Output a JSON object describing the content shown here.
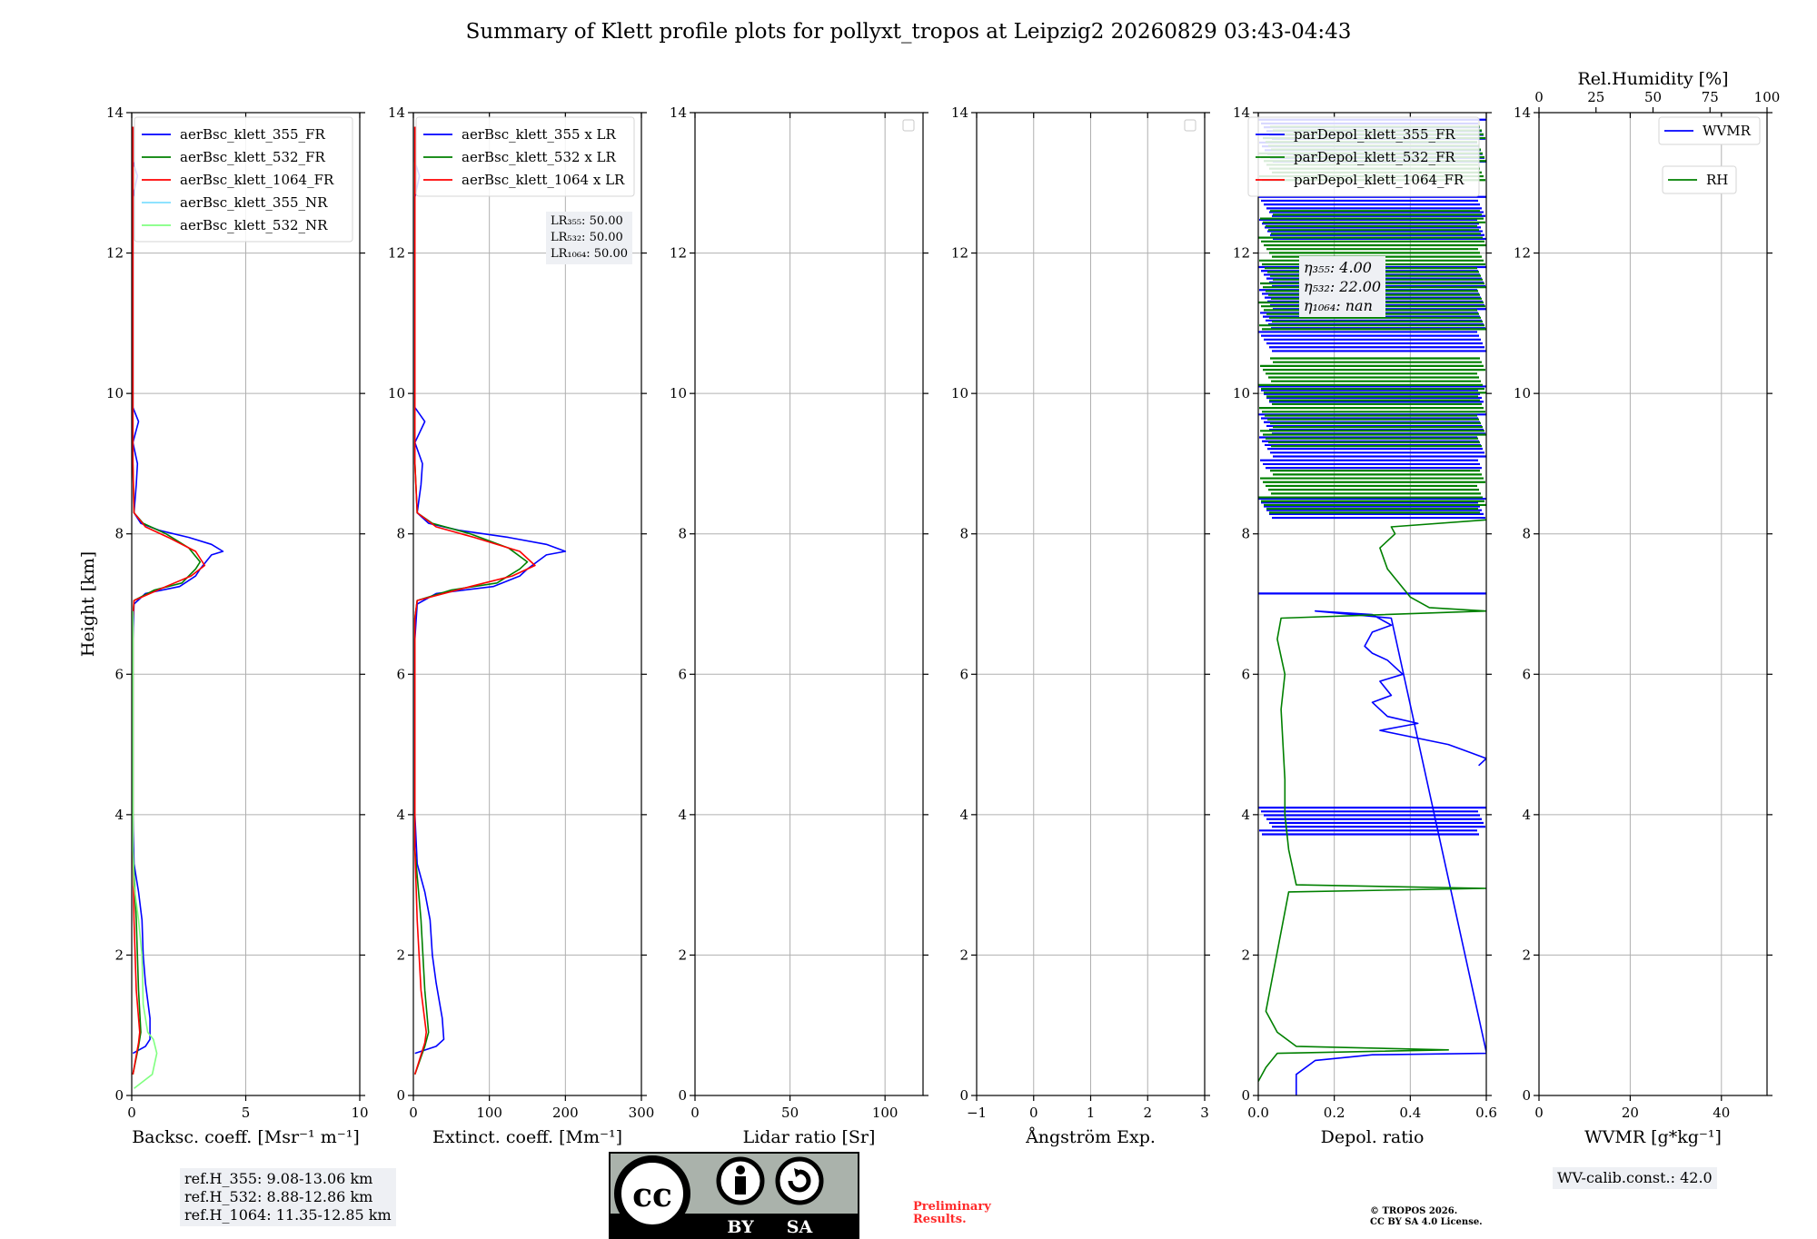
{
  "title": "Summary of Klett profile plots for pollyxt_tropos at Leipzig2 20260829 03:43-04:43",
  "colors": {
    "c355": "#0000ff",
    "c532": "#008000",
    "c1064": "#ff0000",
    "c355nr": "#7fdfff",
    "c532nr": "#80ff80"
  },
  "chart_data": [
    {
      "type": "line",
      "xlabel": "Backsc. coeff. [Msr⁻¹ m⁻¹]",
      "ylabel": "Height [km]",
      "xlim": [
        0,
        10
      ],
      "ylim": [
        0,
        14
      ],
      "xticks": [
        "0",
        "5",
        "10"
      ],
      "yticks": [
        "0",
        "2",
        "4",
        "6",
        "8",
        "10",
        "12",
        "14"
      ],
      "legend": "top-right",
      "series": [
        {
          "name": "aerBsc_klett_355_FR",
          "color": "#0000ff",
          "points": [
            [
              0.05,
              0.6
            ],
            [
              0.6,
              0.7
            ],
            [
              0.8,
              0.8
            ],
            [
              0.8,
              1.1
            ],
            [
              0.6,
              1.6
            ],
            [
              0.5,
              2.0
            ],
            [
              0.45,
              2.5
            ],
            [
              0.3,
              2.9
            ],
            [
              0.1,
              3.3
            ],
            [
              0.05,
              4.0
            ],
            [
              0.05,
              6.5
            ],
            [
              0.1,
              7.0
            ],
            [
              0.6,
              7.15
            ],
            [
              2.1,
              7.25
            ],
            [
              2.8,
              7.4
            ],
            [
              3.0,
              7.5
            ],
            [
              3.5,
              7.7
            ],
            [
              4.0,
              7.75
            ],
            [
              3.5,
              7.85
            ],
            [
              2.5,
              7.95
            ],
            [
              1.2,
              8.05
            ],
            [
              0.4,
              8.15
            ],
            [
              0.1,
              8.3
            ],
            [
              0.2,
              8.7
            ],
            [
              0.25,
              9.0
            ],
            [
              0.05,
              9.3
            ],
            [
              0.3,
              9.6
            ],
            [
              0.05,
              9.8
            ],
            [
              0.05,
              12.8
            ],
            [
              0.25,
              13.1
            ],
            [
              0.05,
              13.3
            ],
            [
              0.05,
              13.8
            ]
          ]
        },
        {
          "name": "aerBsc_klett_532_FR",
          "color": "#008000",
          "points": [
            [
              0.05,
              0.3
            ],
            [
              0.3,
              0.7
            ],
            [
              0.4,
              0.9
            ],
            [
              0.3,
              1.5
            ],
            [
              0.2,
              2.5
            ],
            [
              0.05,
              3.5
            ],
            [
              0.05,
              6.8
            ],
            [
              0.1,
              7.05
            ],
            [
              1.0,
              7.2
            ],
            [
              2.2,
              7.3
            ],
            [
              2.8,
              7.5
            ],
            [
              3.0,
              7.6
            ],
            [
              2.5,
              7.8
            ],
            [
              1.5,
              8.0
            ],
            [
              0.5,
              8.15
            ],
            [
              0.1,
              8.3
            ],
            [
              0.05,
              9.0
            ],
            [
              0.05,
              13.8
            ]
          ]
        },
        {
          "name": "aerBsc_klett_1064_FR",
          "color": "#ff0000",
          "points": [
            [
              0.05,
              0.3
            ],
            [
              0.3,
              0.75
            ],
            [
              0.35,
              0.9
            ],
            [
              0.2,
              1.5
            ],
            [
              0.1,
              2.5
            ],
            [
              0.05,
              3.5
            ],
            [
              0.05,
              6.8
            ],
            [
              0.1,
              7.05
            ],
            [
              1.5,
              7.25
            ],
            [
              2.6,
              7.4
            ],
            [
              3.2,
              7.55
            ],
            [
              2.8,
              7.75
            ],
            [
              1.6,
              7.95
            ],
            [
              0.6,
              8.1
            ],
            [
              0.1,
              8.3
            ],
            [
              0.05,
              9.0
            ],
            [
              0.05,
              13.8
            ]
          ]
        },
        {
          "name": "aerBsc_klett_355_NR",
          "color": "#7fdfff",
          "points": []
        },
        {
          "name": "aerBsc_klett_532_NR",
          "color": "#80ff80",
          "points": [
            [
              0.1,
              0.1
            ],
            [
              0.9,
              0.3
            ],
            [
              1.1,
              0.6
            ],
            [
              0.95,
              0.8
            ],
            [
              0.7,
              0.9
            ],
            [
              0.5,
              1.3
            ],
            [
              0.45,
              2.0
            ],
            [
              0.3,
              2.5
            ],
            [
              0.1,
              3.0
            ],
            [
              0.05,
              3.5
            ],
            [
              0.05,
              6.9
            ]
          ]
        }
      ],
      "info": [
        "ref.H_355: 9.08-13.06 km",
        "ref.H_532: 8.88-12.86 km",
        "ref.H_1064: 11.35-12.85 km"
      ]
    },
    {
      "type": "line",
      "xlabel": "Extinct. coeff. [Mm⁻¹]",
      "xlim": [
        0,
        300
      ],
      "ylim": [
        0,
        14
      ],
      "xticks": [
        "0",
        "100",
        "200",
        "300"
      ],
      "yticks": [
        "0",
        "2",
        "4",
        "6",
        "8",
        "10",
        "12",
        "14"
      ],
      "legend": "top-right",
      "series": [
        {
          "name": "aerBsc_klett_355 x LR",
          "color": "#0000ff",
          "points": [
            [
              2,
              0.6
            ],
            [
              30,
              0.7
            ],
            [
              40,
              0.8
            ],
            [
              38,
              1.1
            ],
            [
              30,
              1.6
            ],
            [
              25,
              2.0
            ],
            [
              22,
              2.5
            ],
            [
              15,
              2.9
            ],
            [
              5,
              3.3
            ],
            [
              2,
              4.0
            ],
            [
              2,
              6.5
            ],
            [
              5,
              7.0
            ],
            [
              30,
              7.15
            ],
            [
              105,
              7.25
            ],
            [
              140,
              7.4
            ],
            [
              150,
              7.5
            ],
            [
              175,
              7.7
            ],
            [
              200,
              7.75
            ],
            [
              175,
              7.85
            ],
            [
              125,
              7.95
            ],
            [
              60,
              8.05
            ],
            [
              20,
              8.15
            ],
            [
              5,
              8.3
            ],
            [
              10,
              8.7
            ],
            [
              12,
              9.0
            ],
            [
              2,
              9.3
            ],
            [
              15,
              9.6
            ],
            [
              2,
              9.8
            ],
            [
              2,
              12.8
            ],
            [
              8,
              13.1
            ],
            [
              2,
              13.3
            ],
            [
              2,
              13.8
            ]
          ]
        },
        {
          "name": "aerBsc_klett_532 x LR",
          "color": "#008000",
          "points": [
            [
              2,
              0.3
            ],
            [
              15,
              0.7
            ],
            [
              20,
              0.9
            ],
            [
              15,
              1.5
            ],
            [
              10,
              2.5
            ],
            [
              2,
              3.5
            ],
            [
              2,
              6.8
            ],
            [
              5,
              7.05
            ],
            [
              50,
              7.2
            ],
            [
              110,
              7.3
            ],
            [
              140,
              7.5
            ],
            [
              150,
              7.6
            ],
            [
              125,
              7.8
            ],
            [
              75,
              8.0
            ],
            [
              25,
              8.15
            ],
            [
              5,
              8.3
            ],
            [
              2,
              9.0
            ],
            [
              2,
              13.8
            ]
          ]
        },
        {
          "name": "aerBsc_klett_1064 x LR",
          "color": "#ff0000",
          "points": [
            [
              2,
              0.3
            ],
            [
              15,
              0.75
            ],
            [
              17,
              0.9
            ],
            [
              10,
              1.5
            ],
            [
              5,
              2.5
            ],
            [
              2,
              3.5
            ],
            [
              2,
              6.8
            ],
            [
              5,
              7.05
            ],
            [
              75,
              7.25
            ],
            [
              130,
              7.4
            ],
            [
              160,
              7.55
            ],
            [
              140,
              7.75
            ],
            [
              80,
              7.95
            ],
            [
              30,
              8.1
            ],
            [
              5,
              8.3
            ],
            [
              2,
              9.0
            ],
            [
              2,
              13.8
            ]
          ]
        }
      ],
      "info": [
        "LR₃₅₅: 50.00",
        "LR₅₃₂: 50.00",
        "LR₁₀₆₄: 50.00"
      ]
    },
    {
      "type": "line",
      "xlabel": "Lidar ratio [Sr]",
      "xlim": [
        0,
        120
      ],
      "ylim": [
        0,
        14
      ],
      "xticks": [
        "0",
        "50",
        "100"
      ],
      "yticks": [
        "0",
        "2",
        "4",
        "6",
        "8",
        "10",
        "12",
        "14"
      ],
      "series": []
    },
    {
      "type": "line",
      "xlabel": "Ångström Exp.",
      "xlim": [
        -1,
        3
      ],
      "ylim": [
        0,
        14
      ],
      "xticks": [
        "−1",
        "0",
        "1",
        "2",
        "3"
      ],
      "yticks": [
        "0",
        "2",
        "4",
        "6",
        "8",
        "10",
        "12",
        "14"
      ],
      "series": []
    },
    {
      "type": "line",
      "xlabel": "Depol. ratio",
      "xlim": [
        0,
        0.6
      ],
      "ylim": [
        0,
        14
      ],
      "xticks": [
        "0.0",
        "0.2",
        "0.4",
        "0.6"
      ],
      "yticks": [
        "0",
        "2",
        "4",
        "6",
        "8",
        "10",
        "12",
        "14"
      ],
      "legend": "top-right",
      "series": [
        {
          "name": "parDepol_klett_355_FR",
          "color": "#0000ff",
          "points": [
            [
              0.1,
              0.0
            ],
            [
              0.1,
              0.3
            ],
            [
              0.15,
              0.5
            ],
            [
              0.3,
              0.58
            ],
            [
              0.6,
              0.6
            ],
            [
              0.6,
              0.62
            ],
            [
              0.35,
              6.8
            ],
            [
              0.15,
              6.9
            ],
            [
              0.3,
              6.85
            ],
            [
              0.35,
              6.7
            ],
            [
              0.3,
              6.6
            ],
            [
              0.28,
              6.4
            ],
            [
              0.3,
              6.3
            ],
            [
              0.34,
              6.2
            ],
            [
              0.38,
              6.0
            ],
            [
              0.32,
              5.9
            ],
            [
              0.35,
              5.7
            ],
            [
              0.3,
              5.6
            ],
            [
              0.34,
              5.4
            ],
            [
              0.42,
              5.3
            ],
            [
              0.32,
              5.2
            ],
            [
              0.5,
              5.0
            ],
            [
              0.55,
              4.9
            ],
            [
              0.6,
              4.8
            ],
            [
              0.58,
              4.7
            ]
          ],
          "horizontal_bands": [
            [
              3.7,
              4.1
            ],
            [
              7.15,
              7.15
            ],
            [
              8.2,
              8.5
            ],
            [
              8.9,
              9.7
            ],
            [
              9.85,
              10.1
            ],
            [
              10.6,
              11.8
            ],
            [
              12.2,
              12.8
            ],
            [
              13.3,
              13.9
            ]
          ]
        },
        {
          "name": "parDepol_klett_532_FR",
          "color": "#008000",
          "points": [
            [
              0.0,
              0.2
            ],
            [
              0.02,
              0.4
            ],
            [
              0.05,
              0.6
            ],
            [
              0.5,
              0.65
            ],
            [
              0.1,
              0.7
            ],
            [
              0.05,
              0.9
            ],
            [
              0.02,
              1.2
            ],
            [
              0.08,
              2.9
            ],
            [
              0.6,
              2.95
            ],
            [
              0.1,
              3.0
            ],
            [
              0.08,
              3.5
            ],
            [
              0.07,
              4.0
            ],
            [
              0.07,
              4.5
            ],
            [
              0.06,
              5.5
            ],
            [
              0.07,
              6.0
            ],
            [
              0.05,
              6.5
            ],
            [
              0.06,
              6.8
            ],
            [
              0.6,
              6.9
            ],
            [
              0.45,
              6.95
            ],
            [
              0.4,
              7.1
            ],
            [
              0.34,
              7.5
            ],
            [
              0.32,
              7.8
            ],
            [
              0.36,
              8.0
            ],
            [
              0.35,
              8.1
            ],
            [
              0.6,
              8.2
            ]
          ],
          "horizontal_bands": [
            [
              8.3,
              8.9
            ],
            [
              9.2,
              10.5
            ],
            [
              10.9,
              12.6
            ],
            [
              13.0,
              13.8
            ]
          ]
        },
        {
          "name": "parDepol_klett_1064_FR",
          "color": "#ff0000",
          "points": []
        }
      ],
      "info": [
        "η₃₅₅: 4.00",
        "η₅₃₂: 22.00",
        "η₁₀₆₄: nan"
      ]
    },
    {
      "type": "line",
      "xlabel": "WVMR [g*kg⁻¹]",
      "top_xlabel": "Rel.Humidity [%]",
      "xlim": [
        0,
        50
      ],
      "ylim": [
        0,
        14
      ],
      "xticks": [
        "0",
        "20",
        "40"
      ],
      "top_xticks": [
        "0",
        "25",
        "50",
        "75",
        "100"
      ],
      "yticks": [
        "0",
        "2",
        "4",
        "6",
        "8",
        "10",
        "12",
        "14"
      ],
      "legend": "top-right",
      "series": [
        {
          "name": "WVMR",
          "color": "#0000ff",
          "points": []
        },
        {
          "name": "RH",
          "color": "#008000",
          "points": []
        }
      ],
      "info": [
        "WV-calib.const.: 42.0"
      ]
    }
  ],
  "footer": {
    "license_badge": "CC BY SA",
    "badge_by": "BY",
    "badge_sa": "SA",
    "preliminary_1": "Preliminary",
    "preliminary_2": "Results.",
    "copyright_1": "© TROPOS 2026.",
    "copyright_2": "CC BY SA 4.0 License."
  }
}
